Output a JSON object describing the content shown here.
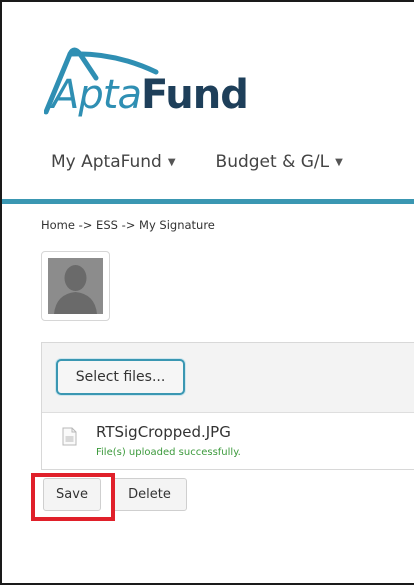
{
  "header": {
    "logo": {
      "text_part1": "Apta",
      "text_part2": "Fund",
      "colors": {
        "apta": "#2f8fb3",
        "fund": "#1e3f5a",
        "accent": "#3a97b2"
      }
    },
    "nav": [
      {
        "label": "My AptaFund",
        "icon": "chevron-down-icon"
      },
      {
        "label": "Budget & G/L",
        "icon": "chevron-down-icon"
      }
    ]
  },
  "breadcrumb": "Home -> ESS -> My Signature",
  "avatar": {
    "icon": "user-silhouette-icon"
  },
  "upload": {
    "select_label": "Select files...",
    "file": {
      "icon": "image-file-icon",
      "name": "RTSigCropped.JPG",
      "status": "File(s) uploaded successfully.",
      "status_color": "#3c9a3c"
    }
  },
  "actions": {
    "save_label": "Save",
    "delete_label": "Delete",
    "highlight_color": "#e0202a"
  }
}
